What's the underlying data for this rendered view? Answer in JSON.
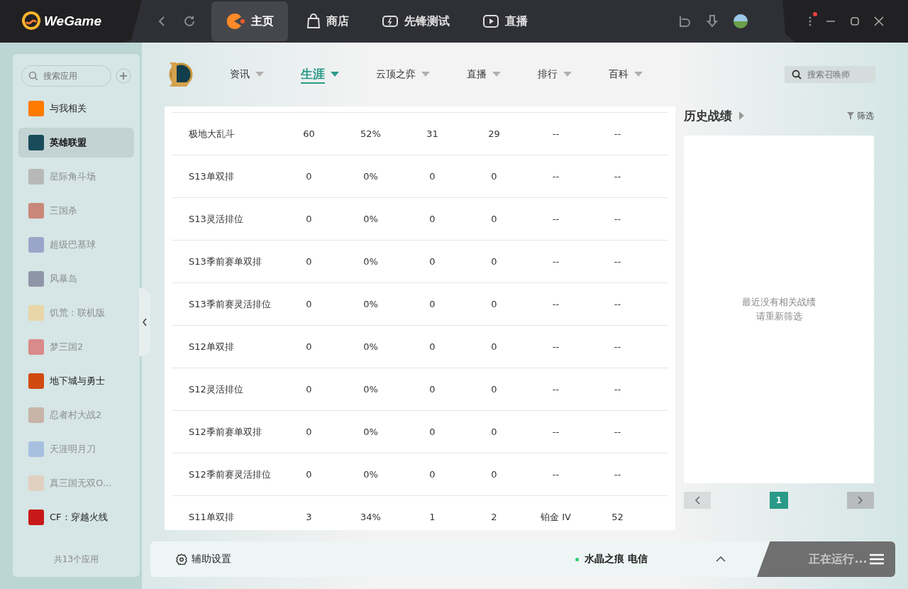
{
  "app": {
    "logo": "WeGame"
  },
  "top_tabs": [
    {
      "label": "主页",
      "selected": true
    },
    {
      "label": "商店",
      "selected": false
    },
    {
      "label": "先锋测试",
      "selected": false
    },
    {
      "label": "直播",
      "selected": false
    }
  ],
  "menu_notification": true,
  "sidebar": {
    "search": {
      "placeholder": "搜索应用"
    },
    "items": [
      {
        "label": "与我相关",
        "selected": false,
        "dimmed": false,
        "color": "#ff7a00"
      },
      {
        "label": "英雄联盟",
        "selected": true,
        "dimmed": false,
        "color": "#1a4b5a"
      },
      {
        "label": "星际角斗场",
        "selected": false,
        "dimmed": true,
        "color": "#b8b8b8"
      },
      {
        "label": "三国杀",
        "selected": false,
        "dimmed": true,
        "color": "#c9877a"
      },
      {
        "label": "超级巴基球",
        "selected": false,
        "dimmed": true,
        "color": "#9aa6c8"
      },
      {
        "label": "风暴岛",
        "selected": false,
        "dimmed": true,
        "color": "#8e96a8"
      },
      {
        "label": "饥荒：联机版",
        "selected": false,
        "dimmed": true,
        "color": "#e8d6a8"
      },
      {
        "label": "梦三国2",
        "selected": false,
        "dimmed": true,
        "color": "#d98a8a"
      },
      {
        "label": "地下城与勇士",
        "selected": false,
        "dimmed": false,
        "color": "#d04a10"
      },
      {
        "label": "忍者村大战2",
        "selected": false,
        "dimmed": true,
        "color": "#c8b4a8"
      },
      {
        "label": "天涯明月刀",
        "selected": false,
        "dimmed": true,
        "color": "#a8c0e0"
      },
      {
        "label": "真三国无双O...",
        "selected": false,
        "dimmed": true,
        "color": "#e0d0c0"
      },
      {
        "label": "CF：穿越火线",
        "selected": false,
        "dimmed": false,
        "color": "#c81818"
      }
    ],
    "footer": "共13个应用"
  },
  "game_nav": {
    "tabs": [
      {
        "label": "资讯",
        "selected": false
      },
      {
        "label": "生涯",
        "selected": true
      },
      {
        "label": "云顶之弈",
        "selected": false
      },
      {
        "label": "直播",
        "selected": false
      },
      {
        "label": "排行",
        "selected": false
      },
      {
        "label": "百科",
        "selected": false
      }
    ],
    "search": {
      "placeholder": "搜索召唤师"
    }
  },
  "table": {
    "rows": [
      [
        "极地大乱斗",
        "60",
        "52%",
        "31",
        "29",
        "--",
        "--"
      ],
      [
        "S13单双排",
        "0",
        "0%",
        "0",
        "0",
        "--",
        "--"
      ],
      [
        "S13灵活排位",
        "0",
        "0%",
        "0",
        "0",
        "--",
        "--"
      ],
      [
        "S13季前赛单双排",
        "0",
        "0%",
        "0",
        "0",
        "--",
        "--"
      ],
      [
        "S13季前赛灵活排位",
        "0",
        "0%",
        "0",
        "0",
        "--",
        "--"
      ],
      [
        "S12单双排",
        "0",
        "0%",
        "0",
        "0",
        "--",
        "--"
      ],
      [
        "S12灵活排位",
        "0",
        "0%",
        "0",
        "0",
        "--",
        "--"
      ],
      [
        "S12季前赛单双排",
        "0",
        "0%",
        "0",
        "0",
        "--",
        "--"
      ],
      [
        "S12季前赛灵活排位",
        "0",
        "0%",
        "0",
        "0",
        "--",
        "--"
      ],
      [
        "S11单双排",
        "3",
        "34%",
        "1",
        "2",
        "铂金 IV",
        "52"
      ]
    ]
  },
  "history": {
    "title": "历史战绩",
    "filter": "筛选",
    "empty": [
      "最近没有相关战绩",
      "请重新筛选"
    ],
    "pages": [
      {
        "label": "1",
        "selected": true
      }
    ]
  },
  "bottom_bar": {
    "settings": "辅助设置",
    "server": "水晶之痕 电信",
    "online": true,
    "status": "正在运行..."
  }
}
